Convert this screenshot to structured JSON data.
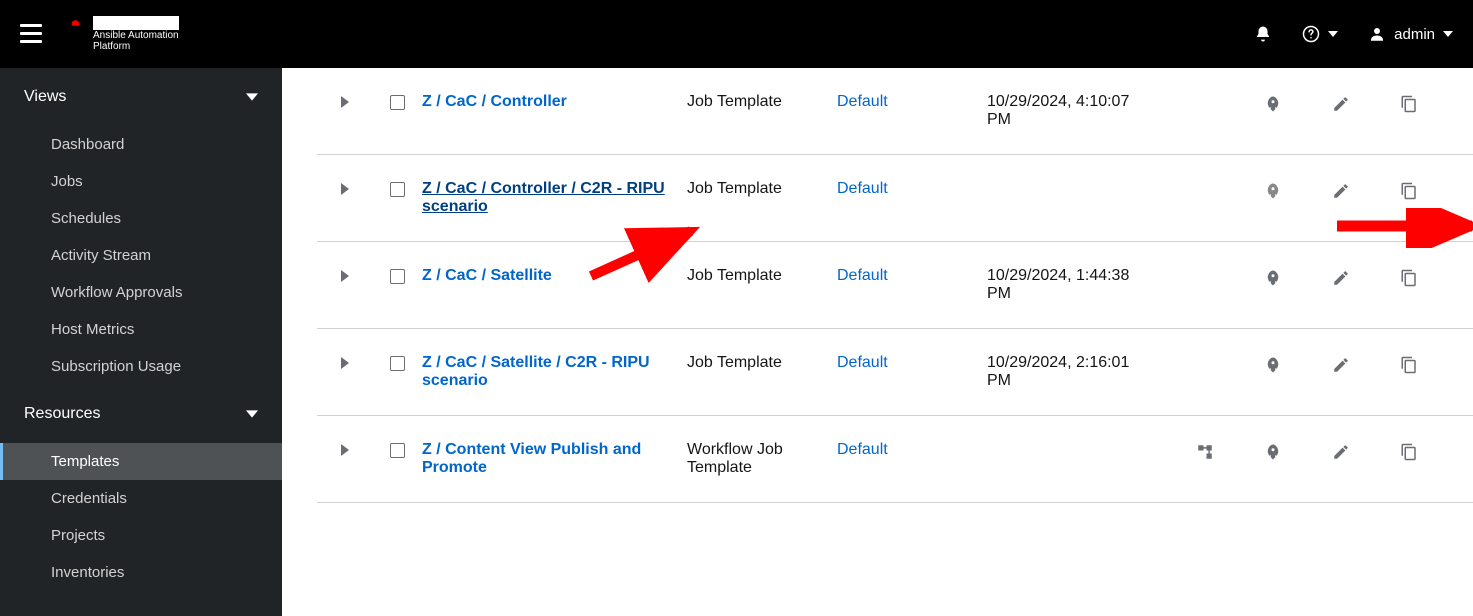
{
  "header": {
    "brand_main": "Red Hat",
    "brand_sub1": "Ansible Automation",
    "brand_sub2": "Platform",
    "user": "admin"
  },
  "sidebar": {
    "sections": [
      {
        "title": "Views",
        "items": [
          {
            "label": "Dashboard",
            "active": false
          },
          {
            "label": "Jobs",
            "active": false
          },
          {
            "label": "Schedules",
            "active": false
          },
          {
            "label": "Activity Stream",
            "active": false
          },
          {
            "label": "Workflow Approvals",
            "active": false
          },
          {
            "label": "Host Metrics",
            "active": false
          },
          {
            "label": "Subscription Usage",
            "active": false
          }
        ]
      },
      {
        "title": "Resources",
        "items": [
          {
            "label": "Templates",
            "active": true
          },
          {
            "label": "Credentials",
            "active": false
          },
          {
            "label": "Projects",
            "active": false
          },
          {
            "label": "Inventories",
            "active": false
          }
        ]
      }
    ]
  },
  "templates": [
    {
      "name": "Z / CaC / Controller",
      "type": "Job Template",
      "org": "Default",
      "ran": "10/29/2024, 4:10:07 PM",
      "workflow": false,
      "hover": false
    },
    {
      "name": "Z / CaC / Controller / C2R - RIPU scenario",
      "type": "Job Template",
      "org": "Default",
      "ran": "",
      "workflow": false,
      "hover": true
    },
    {
      "name": "Z / CaC / Satellite",
      "type": "Job Template",
      "org": "Default",
      "ran": "10/29/2024, 1:44:38 PM",
      "workflow": false,
      "hover": false
    },
    {
      "name": "Z / CaC / Satellite / C2R - RIPU scenario",
      "type": "Job Template",
      "org": "Default",
      "ran": "10/29/2024, 2:16:01 PM",
      "workflow": false,
      "hover": false
    },
    {
      "name": "Z / Content View Publish and Promote",
      "type": "Workflow Job Template",
      "org": "Default",
      "ran": "",
      "workflow": true,
      "hover": false
    }
  ]
}
